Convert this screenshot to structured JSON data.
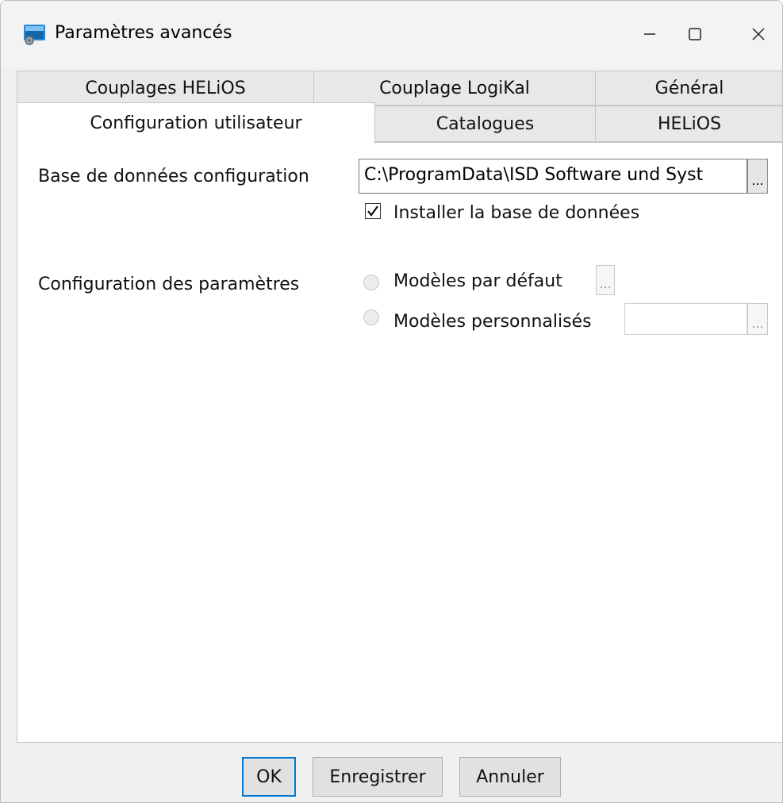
{
  "window": {
    "title": "Paramètres avancés",
    "controls": {
      "minimize": "—",
      "maximize": "☐",
      "close": "✕"
    }
  },
  "tabs": {
    "row_back": [
      "Couplages HELiOS",
      "Couplage LogiKal",
      "Général"
    ],
    "row_front": [
      "Configuration utilisateur",
      "Catalogues",
      "HELiOS"
    ],
    "active": "Configuration utilisateur"
  },
  "config_db": {
    "label": "Base de données configuration",
    "path_value": "C:\\ProgramData\\ISD Software und Syst",
    "browse_label": "...",
    "install_checkbox_label": "Installer la base de données",
    "install_checked": true
  },
  "params": {
    "label": "Configuration des paramètres",
    "options": [
      {
        "label": "Modèles par défaut",
        "selected": false,
        "browse_label": "..."
      },
      {
        "label": "Modèles personnalisés",
        "selected": false,
        "value": "",
        "browse_label": "..."
      }
    ]
  },
  "footer": {
    "ok": "OK",
    "save": "Enregistrer",
    "cancel": "Annuler"
  },
  "colors": {
    "default_button_border": "#0078d7",
    "window_bg": "#f0f0f0",
    "panel_bg": "#ffffff"
  }
}
